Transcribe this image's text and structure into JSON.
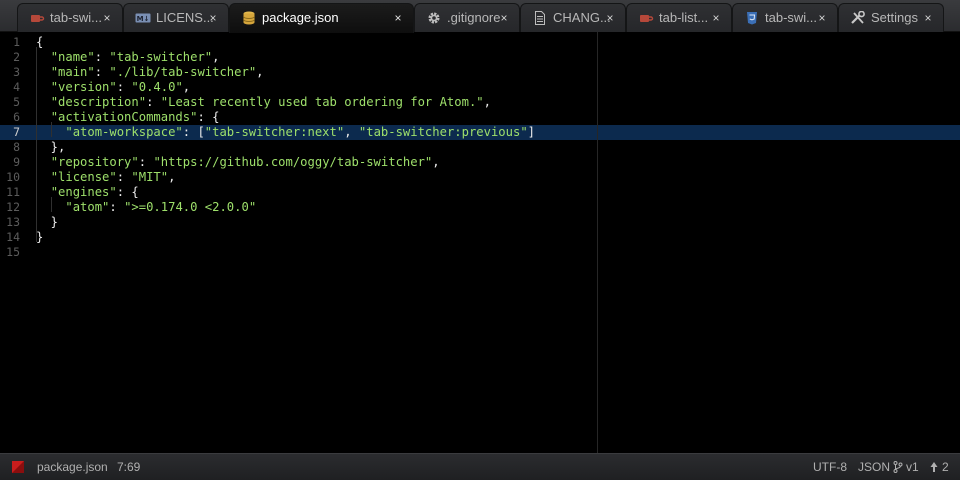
{
  "tabs": [
    {
      "label": "tab-swi...",
      "icon": "ruby-icon",
      "active": false
    },
    {
      "label": "LICENS...",
      "icon": "markdown-icon",
      "active": false
    },
    {
      "label": "package.json",
      "icon": "database-icon",
      "active": true
    },
    {
      "label": ".gitignore",
      "icon": "gear-icon",
      "active": false
    },
    {
      "label": "CHANG...",
      "icon": "file-text-icon",
      "active": false
    },
    {
      "label": "tab-list...",
      "icon": "ruby-icon",
      "active": false
    },
    {
      "label": "tab-swi...",
      "icon": "css-icon",
      "active": false
    },
    {
      "label": "Settings",
      "icon": "tools-icon",
      "active": false
    }
  ],
  "tab_close_glyph": "×",
  "editor": {
    "current_line": 7,
    "line_numbers": [
      "1",
      "2",
      "3",
      "4",
      "5",
      "6",
      "7",
      "8",
      "9",
      "10",
      "11",
      "12",
      "13",
      "14",
      "15"
    ],
    "lines": [
      "{",
      "  \"name\": \"tab-switcher\",",
      "  \"main\": \"./lib/tab-switcher\",",
      "  \"version\": \"0.4.0\",",
      "  \"description\": \"Least recently used tab ordering for Atom.\",",
      "  \"activationCommands\": {",
      "    \"atom-workspace\": [\"tab-switcher:next\", \"tab-switcher:previous\"]",
      "  },",
      "  \"repository\": \"https://github.com/oggy/tab-switcher\",",
      "  \"license\": \"MIT\",",
      "  \"engines\": {",
      "    \"atom\": \">=0.174.0 <2.0.0\"",
      "  }",
      "}",
      ""
    ]
  },
  "status": {
    "file_name": "package.json",
    "cursor_position": "7:69",
    "encoding": "UTF-8",
    "grammar": "JSON",
    "branch": "v1",
    "push_count": "2",
    "branch_icon": "git-branch-icon",
    "push_icon": "arrow-up-icon",
    "file_status_icon": "file-status-icon"
  },
  "colors": {
    "string": "#9ee06b",
    "line_highlight": "#0c2a4e",
    "background": "#000000"
  }
}
